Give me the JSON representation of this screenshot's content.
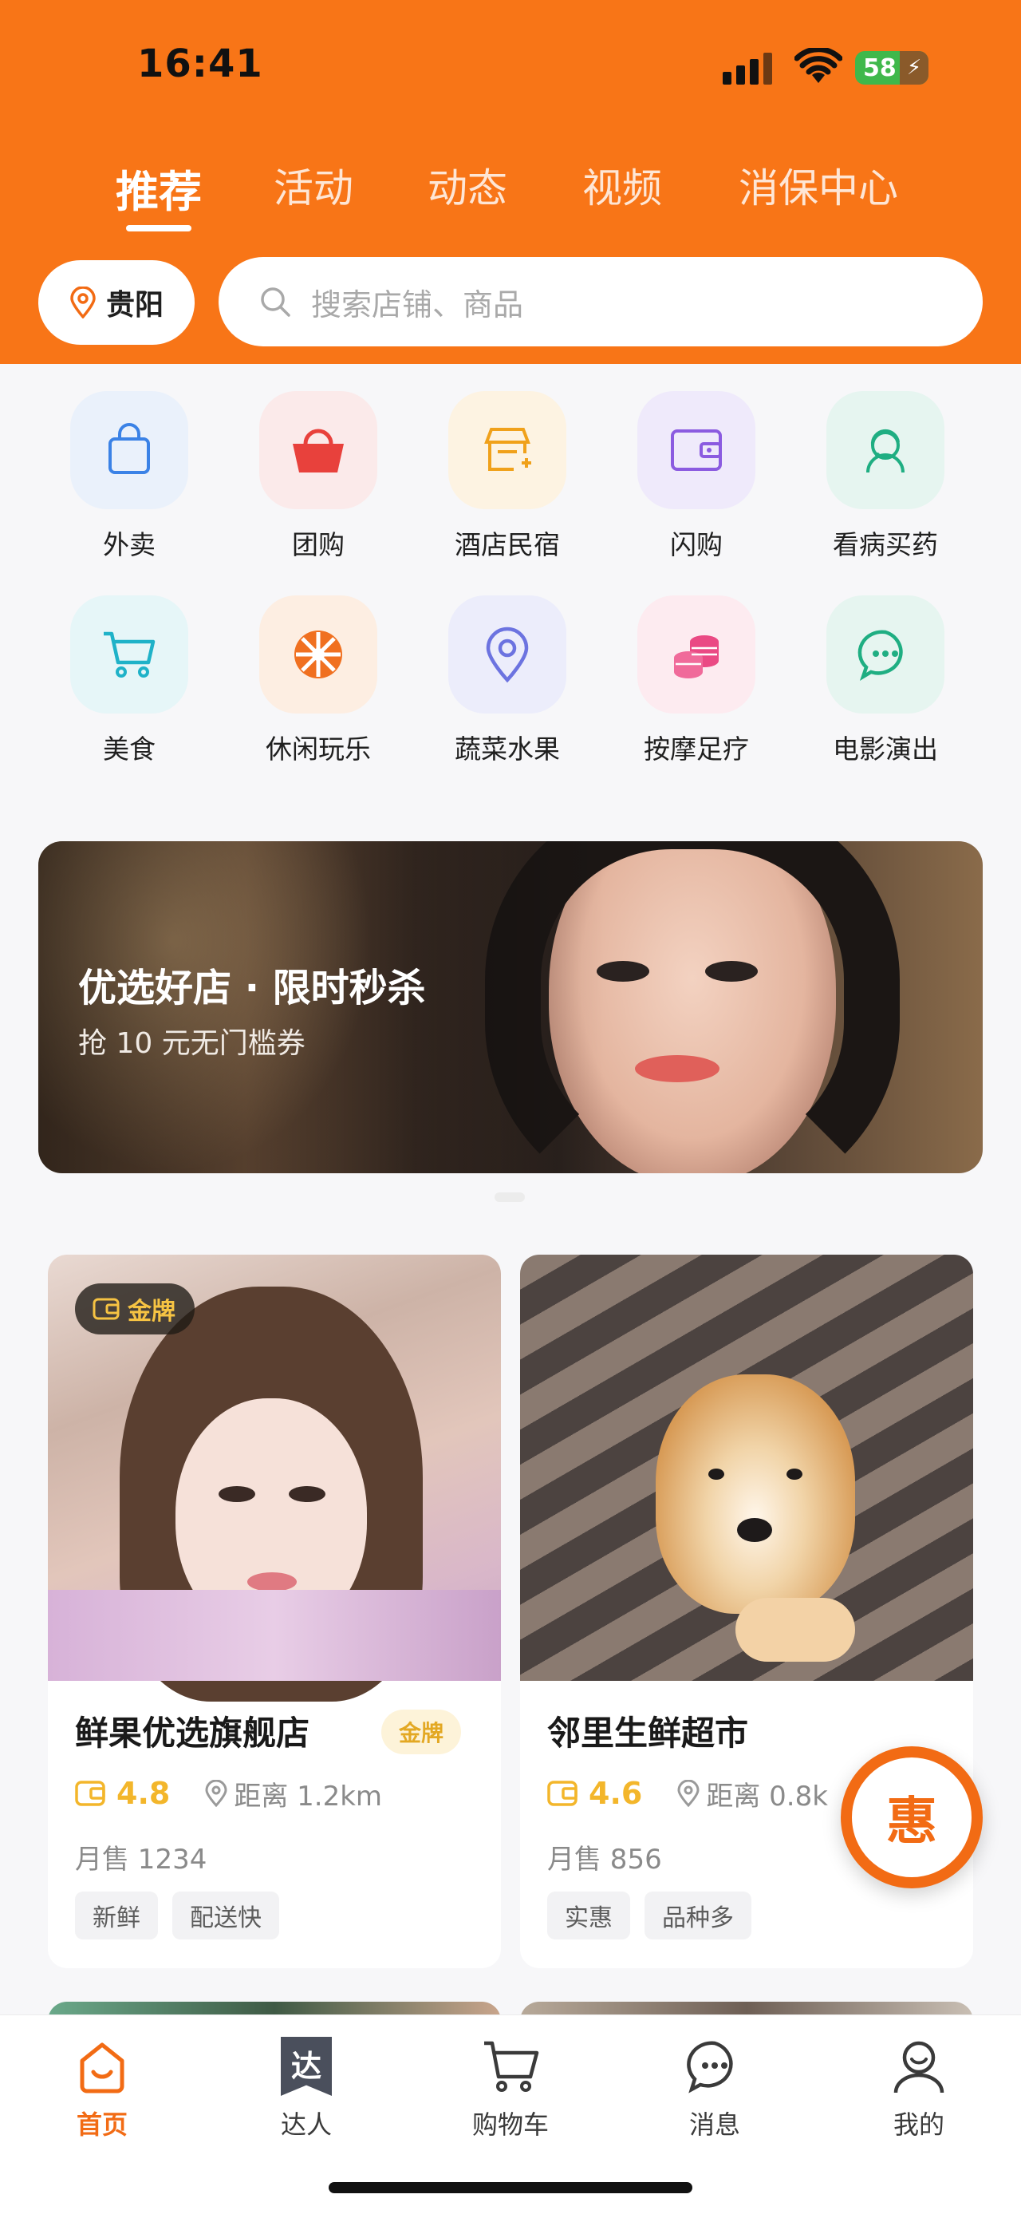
{
  "status_bar": {
    "time": "16:41",
    "battery": "58"
  },
  "top_tabs": [
    {
      "label": "推荐",
      "active": true
    },
    {
      "label": "活动",
      "active": false
    },
    {
      "label": "动态",
      "active": false
    },
    {
      "label": "视频",
      "active": false
    },
    {
      "label": "消保中心",
      "active": false
    }
  ],
  "location": {
    "city": "贵阳"
  },
  "search": {
    "placeholder": "搜索店铺、商品"
  },
  "categories": [
    {
      "label": "外卖",
      "icon": "shopping-bag-icon",
      "bg": "#eaf1fb",
      "color": "#3b82e6"
    },
    {
      "label": "团购",
      "icon": "basket-icon",
      "bg": "#fbeaea",
      "color": "#e8413c"
    },
    {
      "label": "酒店民宿",
      "icon": "hotel-icon",
      "bg": "#fdf3e2",
      "color": "#f0a11b"
    },
    {
      "label": "闪购",
      "icon": "wallet-icon",
      "bg": "#efeafb",
      "color": "#8b5be0"
    },
    {
      "label": "看病买药",
      "icon": "doctor-icon",
      "bg": "#e6f5f0",
      "color": "#1fae82"
    },
    {
      "label": "美食",
      "icon": "cart-icon",
      "bg": "#e6f6f8",
      "color": "#1fb2c8"
    },
    {
      "label": "休闲玩乐",
      "icon": "wheel-icon",
      "bg": "#fdeee2",
      "color": "#f07020"
    },
    {
      "label": "蔬菜水果",
      "icon": "location-pin-icon",
      "bg": "#ecedfb",
      "color": "#6c73e0"
    },
    {
      "label": "按摩足疗",
      "icon": "coins-icon",
      "bg": "#fdebf0",
      "color": "#ea4a84"
    },
    {
      "label": "电影演出",
      "icon": "chat-icon",
      "bg": "#e6f5f0",
      "color": "#1fae82"
    }
  ],
  "banner": {
    "title": "优选好店 · 限时秒杀",
    "subtitle": "抢 10 元无门槛券"
  },
  "stores": [
    {
      "badge": "金牌",
      "name": "鲜果优选旗舰店",
      "tag": "金牌",
      "rating": "4.8",
      "distance": "距离 1.2km",
      "sales": "月售 1234",
      "chips": [
        "新鲜",
        "配送快"
      ]
    },
    {
      "name": "邻里生鲜超市",
      "rating": "4.6",
      "distance": "距离 0.8k",
      "sales": "月售 856",
      "chips": [
        "实惠",
        "品种多"
      ]
    }
  ],
  "fab": {
    "label": "惠"
  },
  "bottom_nav": [
    {
      "label": "首页",
      "icon": "home-icon",
      "active": true
    },
    {
      "label": "达人",
      "icon": "expert-icon",
      "icon_text": "达",
      "active": false
    },
    {
      "label": "购物车",
      "icon": "cart-icon",
      "active": false
    },
    {
      "label": "消息",
      "icon": "message-icon",
      "active": false
    },
    {
      "label": "我的",
      "icon": "profile-icon",
      "active": false
    }
  ],
  "colors": {
    "brand": "#f87517",
    "gold": "#f3b62b",
    "accent": "#f26b14"
  }
}
